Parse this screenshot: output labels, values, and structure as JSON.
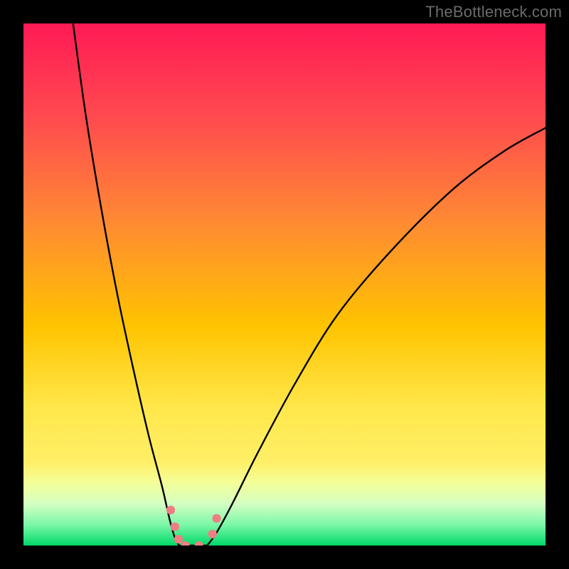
{
  "watermark": "TheBottleneck.com",
  "chart_data": {
    "type": "line",
    "title": "",
    "xlabel": "",
    "ylabel": "",
    "xlim": [
      0,
      100
    ],
    "ylim": [
      0,
      100
    ],
    "background": {
      "gradient": {
        "top": "#ff1a55",
        "mid_upper": "#ff7a33",
        "mid": "#ffc400",
        "mid_lower": "#ffe84d",
        "low_band": "#f4ff99",
        "bottom": "#00e676"
      }
    },
    "series": [
      {
        "name": "left-branch",
        "stroke": "#000000",
        "x": [
          9.5,
          12,
          15,
          18,
          21,
          24,
          26.5,
          28,
          29,
          29.8
        ],
        "y": [
          100,
          82,
          64,
          48,
          34,
          21,
          11.5,
          5,
          1.5,
          0
        ]
      },
      {
        "name": "right-branch",
        "stroke": "#000000",
        "x": [
          35.2,
          37,
          40,
          45,
          52,
          60,
          70,
          82,
          92,
          100
        ],
        "y": [
          0,
          2.5,
          8,
          18,
          31,
          44,
          56,
          68,
          75.5,
          80
        ]
      }
    ],
    "floor_curve": {
      "name": "valley-floor",
      "stroke": "#000000",
      "x": [
        29.8,
        31,
        33,
        35.2
      ],
      "y": [
        0,
        0,
        0,
        0
      ]
    },
    "markers": [
      {
        "name": "marker-left-top",
        "x": 28.2,
        "y": 6.8,
        "color": "#ef7e84",
        "size": 12
      },
      {
        "name": "marker-left-mid",
        "x": 29.0,
        "y": 3.6,
        "color": "#ef7e84",
        "size": 12
      },
      {
        "name": "marker-left-low",
        "x": 29.7,
        "y": 1.2,
        "color": "#ef7e84",
        "size": 12
      },
      {
        "name": "marker-floor-1",
        "x": 31.0,
        "y": 0.0,
        "color": "#ef7e84",
        "size": 12
      },
      {
        "name": "marker-floor-2",
        "x": 33.6,
        "y": 0.0,
        "color": "#ef7e84",
        "size": 12
      },
      {
        "name": "marker-right-low",
        "x": 36.2,
        "y": 2.2,
        "color": "#ef7e84",
        "size": 12
      },
      {
        "name": "marker-right-top",
        "x": 37.0,
        "y": 5.2,
        "color": "#ef7e84",
        "size": 12
      }
    ]
  }
}
